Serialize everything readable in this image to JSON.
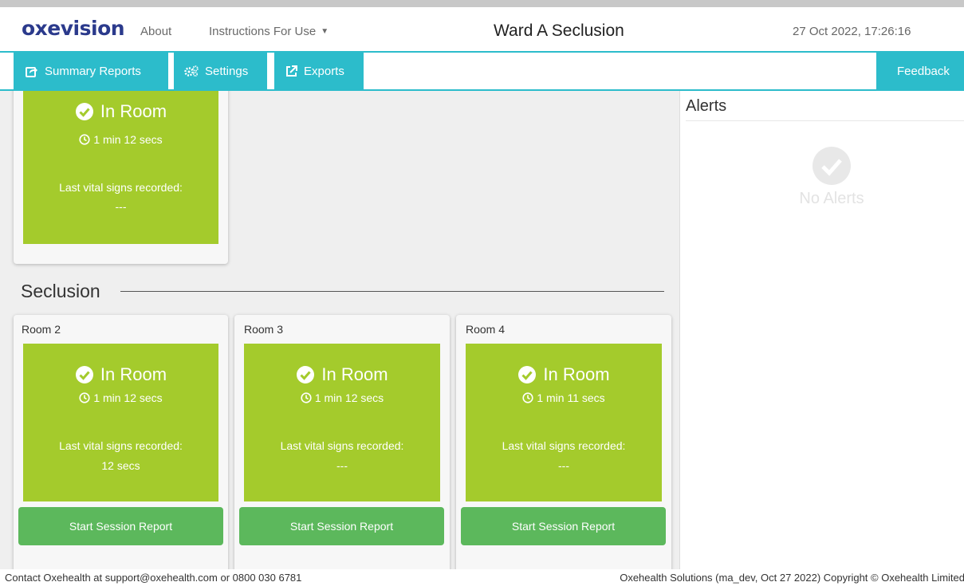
{
  "header": {
    "logo": "oxevision",
    "nav_about": "About",
    "nav_ifu": "Instructions For Use",
    "ward_title": "Ward A Seclusion",
    "datetime": "27 Oct 2022, 17:26:16"
  },
  "toolbar": {
    "summary_reports": "Summary Reports",
    "settings": "Settings",
    "exports": "Exports",
    "feedback": "Feedback"
  },
  "colors": {
    "accent": "#2cbccb",
    "status_green": "#a4cb2c",
    "button_green": "#5cb85c",
    "logo_blue": "#2b3a8c"
  },
  "top_card": {
    "status": "In Room",
    "duration": "1 min 12 secs",
    "vital_label": "Last vital signs recorded:",
    "vital_value": "---"
  },
  "section": {
    "title": "Seclusion"
  },
  "rooms": [
    {
      "name": "Room 2",
      "status": "In Room",
      "duration": "1 min 12 secs",
      "vital_label": "Last vital signs recorded:",
      "vital_value": "12 secs",
      "button": "Start Session Report"
    },
    {
      "name": "Room 3",
      "status": "In Room",
      "duration": "1 min 12 secs",
      "vital_label": "Last vital signs recorded:",
      "vital_value": "---",
      "button": "Start Session Report"
    },
    {
      "name": "Room 4",
      "status": "In Room",
      "duration": "1 min 11 secs",
      "vital_label": "Last vital signs recorded:",
      "vital_value": "---",
      "button": "Start Session Report"
    }
  ],
  "alerts": {
    "title": "Alerts",
    "empty_text": "No Alerts"
  },
  "footer": {
    "contact": "Contact Oxehealth at support@oxehealth.com or 0800 030 6781",
    "copyright": "Oxehealth Solutions (ma_dev, Oct 27 2022) Copyright © Oxehealth Limited"
  }
}
